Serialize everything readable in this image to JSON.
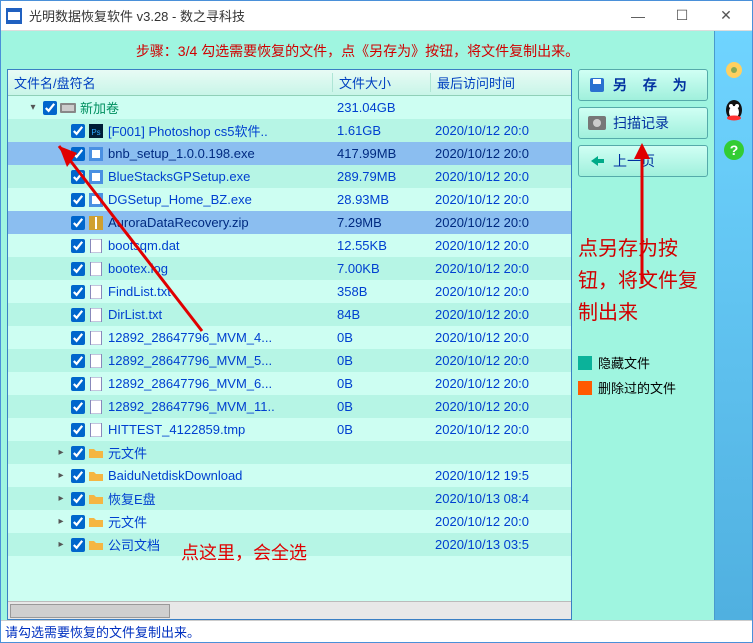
{
  "window": {
    "title": "光明数据恢复软件 v3.28 - 数之寻科技"
  },
  "step_text": "步骤：3/4 勾选需要恢复的文件，点《另存为》按钮，将文件复制出来。",
  "columns": {
    "name": "文件名/盘符名",
    "size": "文件大小",
    "date": "最后访问时间"
  },
  "rows": [
    {
      "indent": 0,
      "expand": "▾",
      "checked": true,
      "icon": "drive",
      "name": "新加卷",
      "size": "231.04GB",
      "date": "",
      "vol": true
    },
    {
      "indent": 1,
      "checked": true,
      "icon": "ps",
      "name": "[F001] Photoshop cs5软件..",
      "size": "1.61GB",
      "date": "2020/10/12 20:0"
    },
    {
      "indent": 1,
      "checked": true,
      "icon": "exe",
      "name": "bnb_setup_1.0.0.198.exe",
      "size": "417.99MB",
      "date": "2020/10/12 20:0",
      "sel": true
    },
    {
      "indent": 1,
      "checked": true,
      "icon": "exe",
      "name": "BlueStacksGPSetup.exe",
      "size": "289.79MB",
      "date": "2020/10/12 20:0"
    },
    {
      "indent": 1,
      "checked": true,
      "icon": "exe",
      "name": "DGSetup_Home_BZ.exe",
      "size": "28.93MB",
      "date": "2020/10/12 20:0"
    },
    {
      "indent": 1,
      "checked": true,
      "icon": "zip",
      "name": "AuroraDataRecovery.zip",
      "size": "7.29MB",
      "date": "2020/10/12 20:0",
      "sel": true
    },
    {
      "indent": 1,
      "checked": true,
      "icon": "file",
      "name": "bootsqm.dat",
      "size": "12.55KB",
      "date": "2020/10/12 20:0"
    },
    {
      "indent": 1,
      "checked": true,
      "icon": "file",
      "name": "bootex.log",
      "size": "7.00KB",
      "date": "2020/10/12 20:0"
    },
    {
      "indent": 1,
      "checked": true,
      "icon": "file",
      "name": "FindList.txt",
      "size": "358B",
      "date": "2020/10/12 20:0"
    },
    {
      "indent": 1,
      "checked": true,
      "icon": "file",
      "name": "DirList.txt",
      "size": "84B",
      "date": "2020/10/12 20:0"
    },
    {
      "indent": 1,
      "checked": true,
      "icon": "file",
      "name": "12892_28647796_MVM_4...",
      "size": "0B",
      "date": "2020/10/12 20:0"
    },
    {
      "indent": 1,
      "checked": true,
      "icon": "file",
      "name": "12892_28647796_MVM_5...",
      "size": "0B",
      "date": "2020/10/12 20:0"
    },
    {
      "indent": 1,
      "checked": true,
      "icon": "file",
      "name": "12892_28647796_MVM_6...",
      "size": "0B",
      "date": "2020/10/12 20:0"
    },
    {
      "indent": 1,
      "checked": true,
      "icon": "file",
      "name": "12892_28647796_MVM_11..",
      "size": "0B",
      "date": "2020/10/12 20:0"
    },
    {
      "indent": 1,
      "checked": true,
      "icon": "file",
      "name": "HITTEST_4122859.tmp",
      "size": "0B",
      "date": "2020/10/12 20:0"
    },
    {
      "indent": 1,
      "expand": "▸",
      "checked": true,
      "icon": "folder",
      "name": "元文件",
      "size": "",
      "date": ""
    },
    {
      "indent": 1,
      "expand": "▸",
      "checked": true,
      "icon": "folder",
      "name": "BaiduNetdiskDownload",
      "size": "",
      "date": "2020/10/12 19:5"
    },
    {
      "indent": 1,
      "expand": "▸",
      "checked": true,
      "icon": "folder",
      "name": "恢复E盘",
      "size": "",
      "date": "2020/10/13 08:4"
    },
    {
      "indent": 1,
      "expand": "▸",
      "checked": true,
      "icon": "folder",
      "name": "元文件",
      "size": "",
      "date": "2020/10/12 20:0"
    },
    {
      "indent": 1,
      "expand": "▸",
      "checked": true,
      "icon": "folder",
      "name": "公司文档",
      "size": "",
      "date": "2020/10/13 03:5"
    }
  ],
  "buttons": {
    "save_as": "另 存 为",
    "scan_log": "扫描记录",
    "prev": "上一页"
  },
  "side_note": "点另存为按钮，将文件复制出来",
  "legend": {
    "hidden": "隐藏文件",
    "deleted": "删除过的文件"
  },
  "anno1": "点这里，会全选",
  "status": "请勾选需要恢复的文件复制出来。"
}
